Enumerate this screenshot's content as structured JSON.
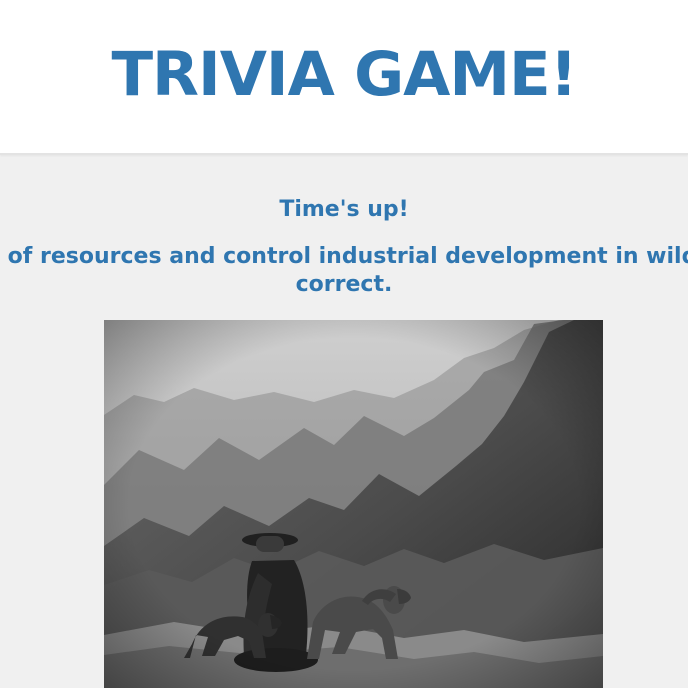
{
  "page": {
    "title": "TRIVIA GAME!",
    "status_message": "Time's up!",
    "answer_line_1": "se of resources and control industrial development in wild",
    "answer_line_2": "correct."
  },
  "image": {
    "subject": "black-and-white photo of a man in a hat sitting on a rocky ledge with two dogs overlooking a mountain valley"
  },
  "colors": {
    "accent": "#2f76b0",
    "header_bg": "#ffffff",
    "page_bg": "#f0f0f0"
  }
}
